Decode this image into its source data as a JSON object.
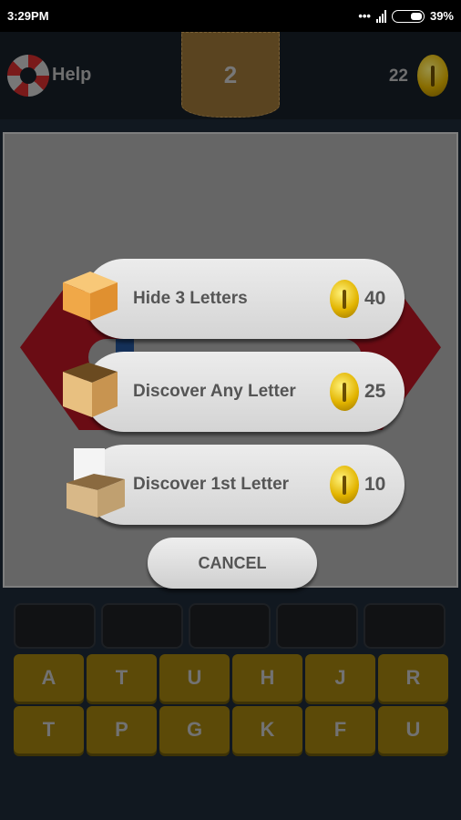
{
  "status_bar": {
    "time": "3:29PM",
    "signal_dots": "•••",
    "battery": "39%"
  },
  "header": {
    "help_label": "Help",
    "level": "2",
    "coins": "22"
  },
  "dialog": {
    "options": [
      {
        "label": "Hide 3 Letters",
        "price": "40",
        "icon": "closed-box-icon"
      },
      {
        "label": "Discover Any Letter",
        "price": "25",
        "icon": "open-crate-icon"
      },
      {
        "label": "Discover 1st Letter",
        "price": "10",
        "icon": "open-cardboard-box-icon"
      }
    ],
    "cancel_label": "CANCEL"
  },
  "answer_slots": [
    "",
    "",
    "",
    "",
    ""
  ],
  "keyboard": {
    "row1": [
      "A",
      "T",
      "U",
      "H",
      "J",
      "R"
    ],
    "row2": [
      "T",
      "P",
      "G",
      "K",
      "F",
      "U"
    ]
  },
  "colors": {
    "key": "#5c4a08",
    "ring": "#6a0c14",
    "dialog": "#666666"
  }
}
